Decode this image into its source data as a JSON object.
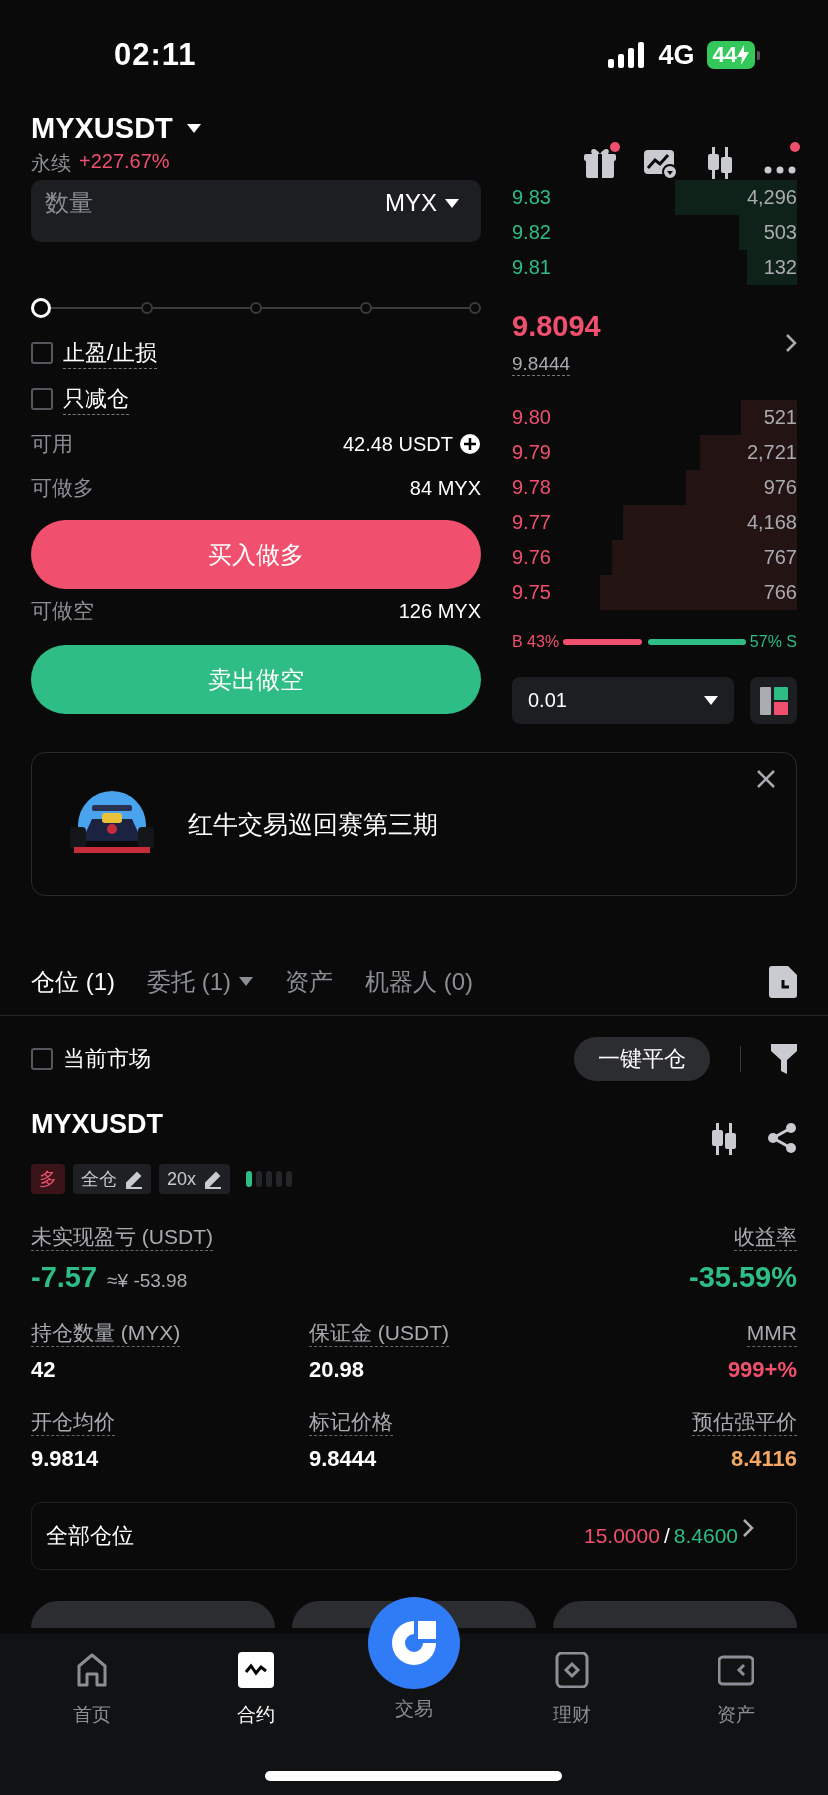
{
  "status_bar": {
    "time": "02:11",
    "network": "4G",
    "battery": "44"
  },
  "header": {
    "symbol": "MYXUSDT",
    "contract_type": "永续",
    "change": "+227.67%"
  },
  "toolbar_icons": [
    {
      "kind": "gift",
      "badge": true
    },
    {
      "kind": "chart",
      "badge": false
    },
    {
      "kind": "candles",
      "badge": false
    },
    {
      "kind": "more",
      "badge": true
    }
  ],
  "order_form": {
    "quantity": {
      "placeholder": "数量",
      "unit": "MYX"
    },
    "slider": {
      "level": 0
    },
    "options": [
      {
        "label": "止盈/止损",
        "checked": false
      },
      {
        "label": "只减仓",
        "checked": false
      }
    ],
    "available": {
      "label": "可用",
      "value": "42.48 USDT"
    },
    "long_max": {
      "label": "可做多",
      "value": "84 MYX"
    },
    "buy_button": "买入做多",
    "short_max": {
      "label": "可做空",
      "value": "126 MYX"
    },
    "sell_button": "卖出做空"
  },
  "order_book": {
    "asks": [
      {
        "price": "9.83",
        "amount": "4,296"
      },
      {
        "price": "9.82",
        "amount": "503"
      },
      {
        "price": "9.81",
        "amount": "132"
      }
    ],
    "last_price": "9.8094",
    "mark_price": "9.8444",
    "bids": [
      {
        "price": "9.80",
        "amount": "521"
      },
      {
        "price": "9.79",
        "amount": "2,721"
      },
      {
        "price": "9.78",
        "amount": "976"
      },
      {
        "price": "9.77",
        "amount": "4,168"
      },
      {
        "price": "9.76",
        "amount": "767"
      },
      {
        "price": "9.75",
        "amount": "766"
      }
    ],
    "ratio": {
      "buy_label": "B 43%",
      "sell_label": "57% S"
    },
    "precision": "0.01"
  },
  "banner": {
    "kind": "picture",
    "title": "红牛交易巡回赛第三期"
  },
  "tabs": [
    {
      "label": "仓位 (1)",
      "selected": true,
      "dropdown": false
    },
    {
      "label": "委托 (1)",
      "selected": false,
      "dropdown": true
    },
    {
      "label": "资产",
      "selected": false,
      "dropdown": false
    },
    {
      "label": "机器人 (0)",
      "selected": false,
      "dropdown": false
    }
  ],
  "filter": {
    "label": "当前市场",
    "checked": false,
    "close_all": "一键平仓"
  },
  "position": {
    "symbol": "MYXUSDT",
    "side": "多",
    "margin_mode": "全仓",
    "leverage": "20x",
    "rows": [
      {
        "kind": "large",
        "cells": [
          {
            "label": "未实现盈亏 (USDT)",
            "value": "-7.57",
            "sub": "≈¥ -53.98",
            "color": "#2ebd85"
          },
          "",
          {
            "label": "收益率",
            "value": "-35.59%",
            "color": "#2ebd85"
          }
        ]
      },
      {
        "kind": "normal",
        "cells": [
          {
            "label": "持仓数量 (MYX)",
            "value": "42",
            "color": "#ffffff"
          },
          {
            "label": "保证金 (USDT)",
            "value": "20.98",
            "color": "#ffffff"
          },
          {
            "label": "MMR",
            "value": "999+%",
            "color": "#f0506e"
          }
        ]
      },
      {
        "kind": "normal",
        "cells": [
          {
            "label": "开仓均价",
            "value": "9.9814",
            "color": "#ffffff"
          },
          {
            "label": "标记价格",
            "value": "9.8444",
            "color": "#ffffff"
          },
          {
            "label": "预估强平价",
            "value": "8.4116",
            "color": "#f5a766"
          }
        ]
      }
    ],
    "total": {
      "label": "全部仓位",
      "value_a": "15.0000",
      "separator": "/",
      "value_b": "8.4600"
    }
  },
  "nav": [
    {
      "label": "首页",
      "kind": "home",
      "selected": false
    },
    {
      "label": "合约",
      "kind": "contract",
      "selected": true
    },
    {
      "label": "交易",
      "kind": "trade",
      "selected": false
    },
    {
      "label": "理财",
      "kind": "finance",
      "selected": false
    },
    {
      "label": "资产",
      "kind": "wallet",
      "selected": false
    }
  ]
}
